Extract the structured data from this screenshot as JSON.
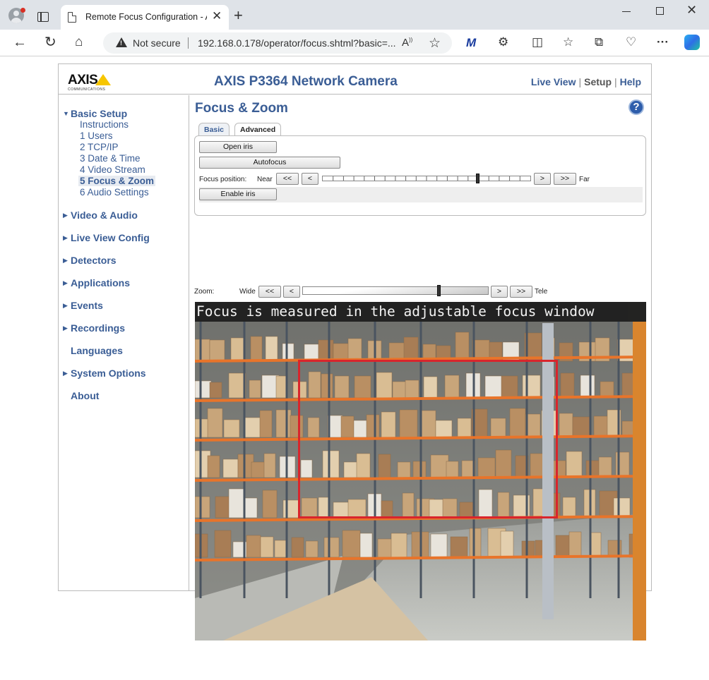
{
  "browser": {
    "tab_title": "Remote Focus Configuration - AXIS",
    "security_label": "Not secure",
    "url": "192.168.0.178/operator/focus.shtml?basic=..."
  },
  "header": {
    "logo_text": "AXIS",
    "logo_subtext": "COMMUNICATIONS",
    "camera_title": "AXIS P3364 Network Camera",
    "nav": {
      "live_view": "Live View",
      "setup": "Setup",
      "help": "Help"
    }
  },
  "sidebar": {
    "basic_setup": "Basic Setup",
    "basic_items": [
      "Instructions",
      "1 Users",
      "2 TCP/IP",
      "3 Date & Time",
      "4 Video Stream",
      "5 Focus & Zoom",
      "6 Audio Settings"
    ],
    "sections": [
      "Video & Audio",
      "Live View Config",
      "Detectors",
      "Applications",
      "Events",
      "Recordings",
      "Languages",
      "System Options",
      "About"
    ]
  },
  "main": {
    "title": "Focus & Zoom",
    "help_glyph": "?",
    "tabs": {
      "basic": "Basic",
      "advanced": "Advanced"
    },
    "buttons": {
      "open_iris": "Open iris",
      "autofocus": "Autofocus",
      "enable_iris": "Enable iris"
    },
    "focus": {
      "label": "Focus position:",
      "near": "Near",
      "far": "Far",
      "level": 0.75
    },
    "zoom": {
      "label": "Zoom:",
      "wide": "Wide",
      "tele": "Tele",
      "level": 0.74
    },
    "step": {
      "big_back": "<<",
      "back": "<",
      "fwd": ">",
      "big_fwd": ">>"
    },
    "video_caption": "Focus is measured in the adjustable focus window"
  },
  "colors": {
    "link": "#3a5d95",
    "focus_window": "#d9252c",
    "logo_yellow": "#f7c600"
  },
  "icons": [
    "profile-icon",
    "tab-actions-icon",
    "page-icon",
    "close-icon",
    "plus-icon",
    "back-icon",
    "refresh-icon",
    "home-icon",
    "warning-icon",
    "read-aloud-icon",
    "star-icon",
    "extension-icon",
    "split-screen-icon",
    "favorites-icon",
    "collections-icon",
    "browser-essentials-icon",
    "more-icon",
    "copilot-icon",
    "help-icon"
  ]
}
